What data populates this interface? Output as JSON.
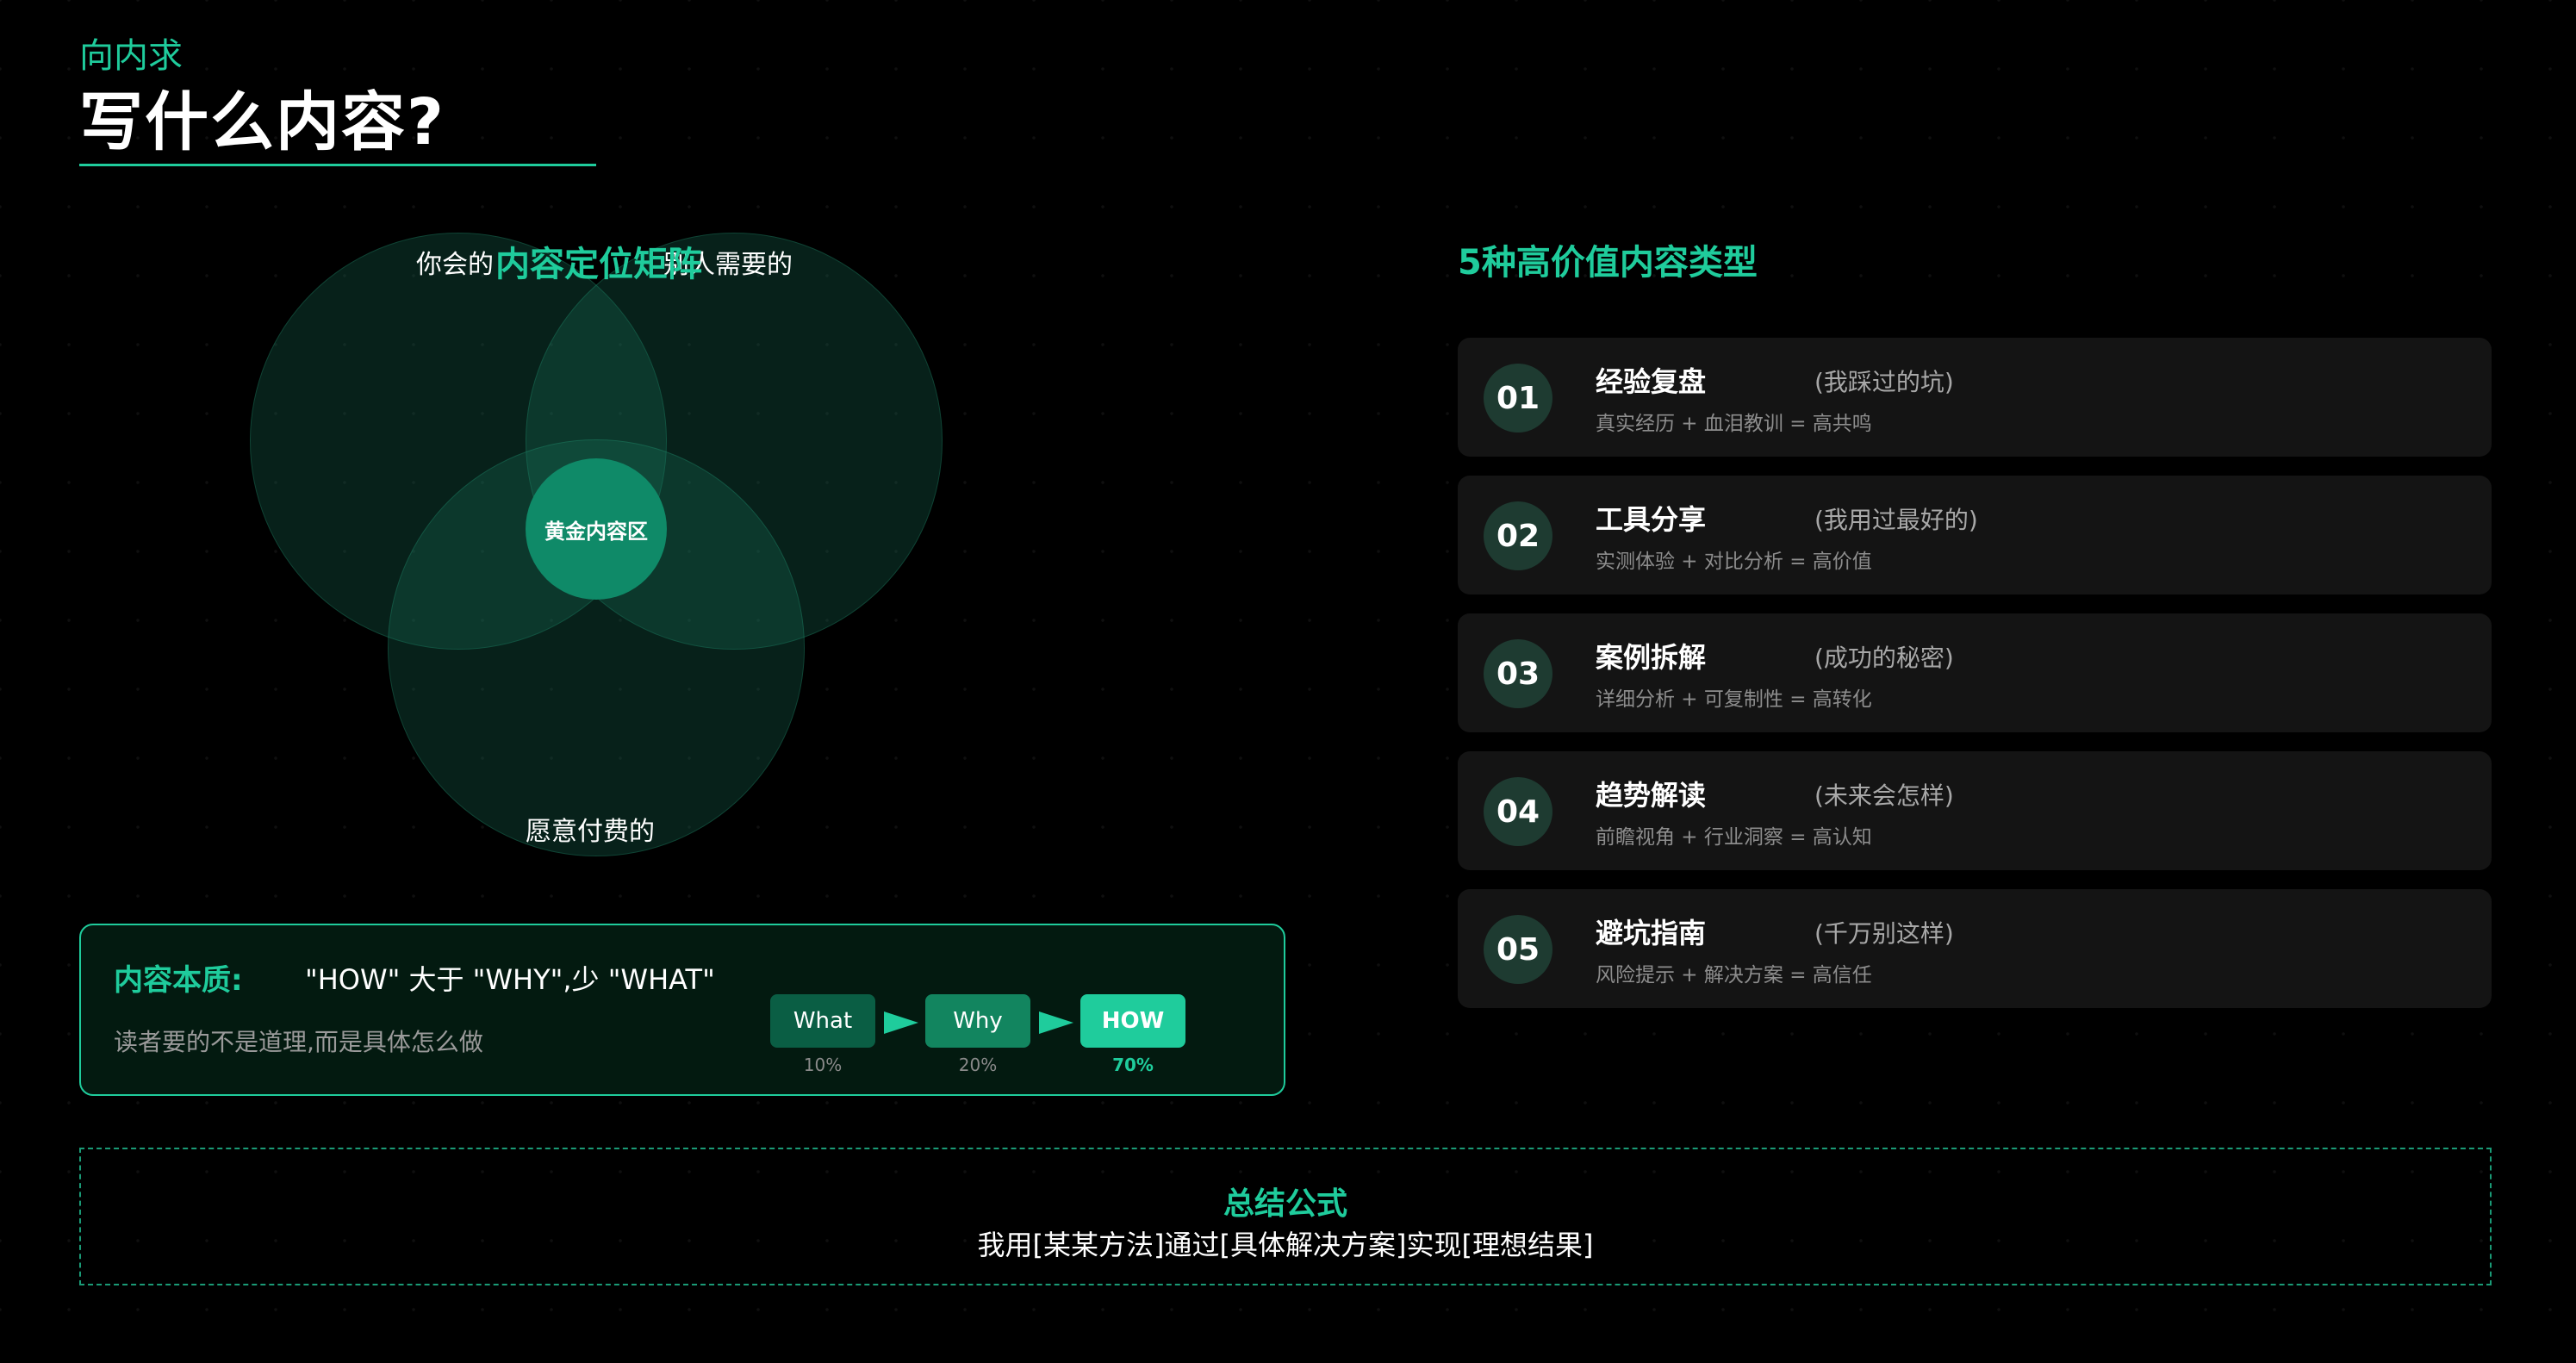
{
  "header": {
    "subtitle": "向内求",
    "title": "写什么内容?"
  },
  "venn": {
    "title": "内容定位矩阵",
    "label_left": "你会的",
    "label_right": "别人需要的",
    "label_bottom": "愿意付费的",
    "center": "黄金内容区"
  },
  "essence": {
    "label": "内容本质:",
    "quote": "\"HOW\" 大于 \"WHY\",少 \"WHAT\"",
    "desc": "读者要的不是道理,而是具体怎么做",
    "steps": [
      {
        "label": "What",
        "pct": "10%"
      },
      {
        "label": "Why",
        "pct": "20%"
      },
      {
        "label": "HOW",
        "pct": "70%"
      }
    ]
  },
  "content_types": {
    "title": "5种高价值内容类型",
    "items": [
      {
        "num": "01",
        "title": "经验复盘",
        "note": "(我踩过的坑)",
        "desc": "真实经历 + 血泪教训 = 高共鸣"
      },
      {
        "num": "02",
        "title": "工具分享",
        "note": "(我用过最好的)",
        "desc": "实测体验 + 对比分析 = 高价值"
      },
      {
        "num": "03",
        "title": "案例拆解",
        "note": "(成功的秘密)",
        "desc": "详细分析 + 可复制性 = 高转化"
      },
      {
        "num": "04",
        "title": "趋势解读",
        "note": "(未来会怎样)",
        "desc": "前瞻视角 + 行业洞察 = 高认知"
      },
      {
        "num": "05",
        "title": "避坑指南",
        "note": "(千万别这样)",
        "desc": "风险提示 + 解决方案 = 高信任"
      }
    ]
  },
  "summary": {
    "title": "总结公式",
    "text": "我用[某某方法]通过[具体解决方案]实现[理想结果]"
  },
  "colors": {
    "accent": "#1fcc9c",
    "background": "#000000",
    "card": "#141414"
  }
}
